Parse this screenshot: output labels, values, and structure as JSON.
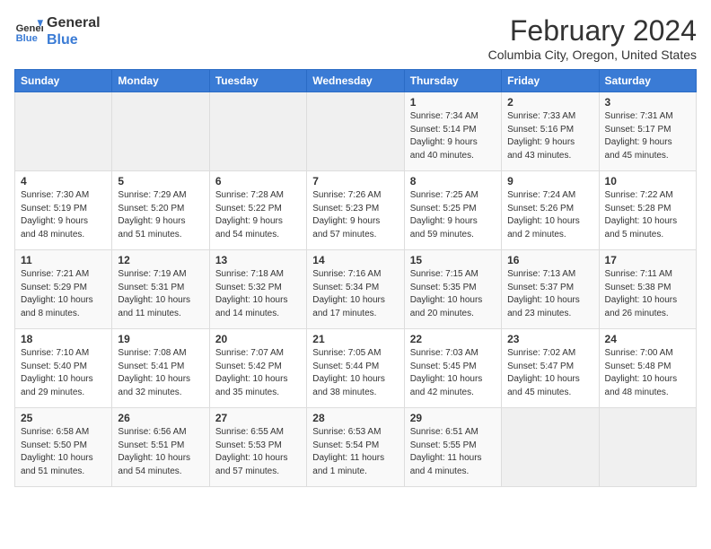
{
  "header": {
    "logo_line1": "General",
    "logo_line2": "Blue",
    "month": "February 2024",
    "location": "Columbia City, Oregon, United States"
  },
  "days_of_week": [
    "Sunday",
    "Monday",
    "Tuesday",
    "Wednesday",
    "Thursday",
    "Friday",
    "Saturday"
  ],
  "weeks": [
    [
      {
        "day": "",
        "info": ""
      },
      {
        "day": "",
        "info": ""
      },
      {
        "day": "",
        "info": ""
      },
      {
        "day": "",
        "info": ""
      },
      {
        "day": "1",
        "info": "Sunrise: 7:34 AM\nSunset: 5:14 PM\nDaylight: 9 hours\nand 40 minutes."
      },
      {
        "day": "2",
        "info": "Sunrise: 7:33 AM\nSunset: 5:16 PM\nDaylight: 9 hours\nand 43 minutes."
      },
      {
        "day": "3",
        "info": "Sunrise: 7:31 AM\nSunset: 5:17 PM\nDaylight: 9 hours\nand 45 minutes."
      }
    ],
    [
      {
        "day": "4",
        "info": "Sunrise: 7:30 AM\nSunset: 5:19 PM\nDaylight: 9 hours\nand 48 minutes."
      },
      {
        "day": "5",
        "info": "Sunrise: 7:29 AM\nSunset: 5:20 PM\nDaylight: 9 hours\nand 51 minutes."
      },
      {
        "day": "6",
        "info": "Sunrise: 7:28 AM\nSunset: 5:22 PM\nDaylight: 9 hours\nand 54 minutes."
      },
      {
        "day": "7",
        "info": "Sunrise: 7:26 AM\nSunset: 5:23 PM\nDaylight: 9 hours\nand 57 minutes."
      },
      {
        "day": "8",
        "info": "Sunrise: 7:25 AM\nSunset: 5:25 PM\nDaylight: 9 hours\nand 59 minutes."
      },
      {
        "day": "9",
        "info": "Sunrise: 7:24 AM\nSunset: 5:26 PM\nDaylight: 10 hours\nand 2 minutes."
      },
      {
        "day": "10",
        "info": "Sunrise: 7:22 AM\nSunset: 5:28 PM\nDaylight: 10 hours\nand 5 minutes."
      }
    ],
    [
      {
        "day": "11",
        "info": "Sunrise: 7:21 AM\nSunset: 5:29 PM\nDaylight: 10 hours\nand 8 minutes."
      },
      {
        "day": "12",
        "info": "Sunrise: 7:19 AM\nSunset: 5:31 PM\nDaylight: 10 hours\nand 11 minutes."
      },
      {
        "day": "13",
        "info": "Sunrise: 7:18 AM\nSunset: 5:32 PM\nDaylight: 10 hours\nand 14 minutes."
      },
      {
        "day": "14",
        "info": "Sunrise: 7:16 AM\nSunset: 5:34 PM\nDaylight: 10 hours\nand 17 minutes."
      },
      {
        "day": "15",
        "info": "Sunrise: 7:15 AM\nSunset: 5:35 PM\nDaylight: 10 hours\nand 20 minutes."
      },
      {
        "day": "16",
        "info": "Sunrise: 7:13 AM\nSunset: 5:37 PM\nDaylight: 10 hours\nand 23 minutes."
      },
      {
        "day": "17",
        "info": "Sunrise: 7:11 AM\nSunset: 5:38 PM\nDaylight: 10 hours\nand 26 minutes."
      }
    ],
    [
      {
        "day": "18",
        "info": "Sunrise: 7:10 AM\nSunset: 5:40 PM\nDaylight: 10 hours\nand 29 minutes."
      },
      {
        "day": "19",
        "info": "Sunrise: 7:08 AM\nSunset: 5:41 PM\nDaylight: 10 hours\nand 32 minutes."
      },
      {
        "day": "20",
        "info": "Sunrise: 7:07 AM\nSunset: 5:42 PM\nDaylight: 10 hours\nand 35 minutes."
      },
      {
        "day": "21",
        "info": "Sunrise: 7:05 AM\nSunset: 5:44 PM\nDaylight: 10 hours\nand 38 minutes."
      },
      {
        "day": "22",
        "info": "Sunrise: 7:03 AM\nSunset: 5:45 PM\nDaylight: 10 hours\nand 42 minutes."
      },
      {
        "day": "23",
        "info": "Sunrise: 7:02 AM\nSunset: 5:47 PM\nDaylight: 10 hours\nand 45 minutes."
      },
      {
        "day": "24",
        "info": "Sunrise: 7:00 AM\nSunset: 5:48 PM\nDaylight: 10 hours\nand 48 minutes."
      }
    ],
    [
      {
        "day": "25",
        "info": "Sunrise: 6:58 AM\nSunset: 5:50 PM\nDaylight: 10 hours\nand 51 minutes."
      },
      {
        "day": "26",
        "info": "Sunrise: 6:56 AM\nSunset: 5:51 PM\nDaylight: 10 hours\nand 54 minutes."
      },
      {
        "day": "27",
        "info": "Sunrise: 6:55 AM\nSunset: 5:53 PM\nDaylight: 10 hours\nand 57 minutes."
      },
      {
        "day": "28",
        "info": "Sunrise: 6:53 AM\nSunset: 5:54 PM\nDaylight: 11 hours\nand 1 minute."
      },
      {
        "day": "29",
        "info": "Sunrise: 6:51 AM\nSunset: 5:55 PM\nDaylight: 11 hours\nand 4 minutes."
      },
      {
        "day": "",
        "info": ""
      },
      {
        "day": "",
        "info": ""
      }
    ]
  ]
}
